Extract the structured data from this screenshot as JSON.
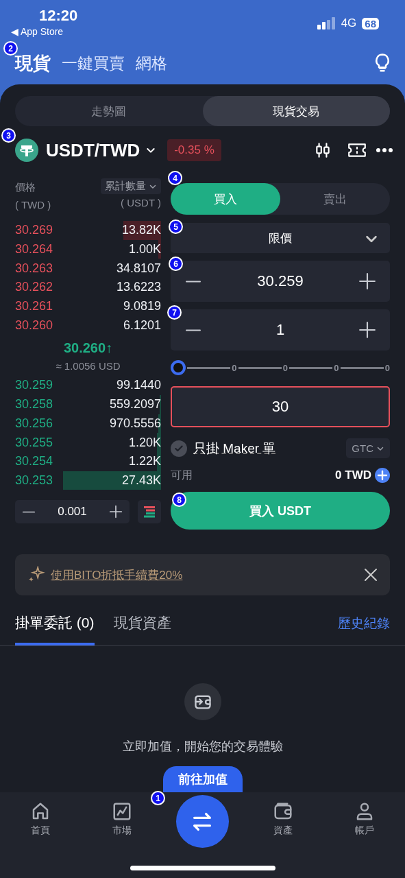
{
  "status_bar": {
    "time": "12:20",
    "back_label": "◀ App Store",
    "network": "4G",
    "battery": "68"
  },
  "header": {
    "tabs": [
      {
        "label": "現貨",
        "selected": true
      },
      {
        "label": "一鍵買賣",
        "selected": false
      },
      {
        "label": "網格",
        "selected": false
      }
    ]
  },
  "view_switch": [
    {
      "label": "走勢圖",
      "selected": false
    },
    {
      "label": "現貨交易",
      "selected": true
    }
  ],
  "pair": {
    "symbol": "USDT/TWD",
    "change": "-0.35 %"
  },
  "order_book": {
    "price_header": "價格",
    "price_unit": "( TWD )",
    "qty_selector": "累計數量",
    "qty_unit": "( USDT )",
    "asks": [
      {
        "price": "30.269",
        "qty": "13.82K"
      },
      {
        "price": "30.264",
        "qty": "1.00K"
      },
      {
        "price": "30.263",
        "qty": "34.8107"
      },
      {
        "price": "30.262",
        "qty": "13.6223"
      },
      {
        "price": "30.261",
        "qty": "9.0819"
      },
      {
        "price": "30.260",
        "qty": "6.1201"
      }
    ],
    "last_price": "30.260↑",
    "fiat": "≈ 1.0056 USD",
    "bids": [
      {
        "price": "30.259",
        "qty": "99.1440"
      },
      {
        "price": "30.258",
        "qty": "559.2097"
      },
      {
        "price": "30.256",
        "qty": "970.5556"
      },
      {
        "price": "30.255",
        "qty": "1.20K"
      },
      {
        "price": "30.254",
        "qty": "1.22K"
      },
      {
        "price": "30.253",
        "qty": "27.43K"
      }
    ],
    "step": "0.001"
  },
  "order_form": {
    "sides": [
      {
        "label": "買入",
        "selected": true
      },
      {
        "label": "賣出",
        "selected": false
      }
    ],
    "order_type": "限價",
    "price": "30.259",
    "amount": "1",
    "slider": {
      "marks": [
        "0",
        "0",
        "0",
        "0"
      ]
    },
    "total": "30",
    "total_error": true,
    "maker_only": {
      "label": "只掛 Maker 單",
      "checked": false
    },
    "time_in_force": "GTC",
    "available_label": "可用",
    "available": "0 TWD",
    "submit": "買入 USDT"
  },
  "promo": {
    "text": "使用BITO折抵手續費20%"
  },
  "orders": {
    "tabs": [
      {
        "label": "掛單委託 (0)",
        "selected": true
      },
      {
        "label": "現貨資產",
        "selected": false
      }
    ],
    "history_link": "歷史紀錄",
    "empty_text": "立即加值，開始您的交易體驗",
    "deposit_button": "前往加值"
  },
  "nav": [
    {
      "label": "首頁",
      "kind": "home"
    },
    {
      "label": "市場",
      "kind": "market"
    },
    {
      "kind": "swap"
    },
    {
      "label": "資產",
      "kind": "wallet"
    },
    {
      "label": "帳戶",
      "kind": "account"
    }
  ],
  "annotations": [
    {
      "label": "2"
    },
    {
      "label": "3"
    },
    {
      "label": "4"
    },
    {
      "label": "5"
    },
    {
      "label": "6"
    },
    {
      "label": "7"
    },
    {
      "label": "8"
    },
    {
      "label": "1"
    }
  ]
}
